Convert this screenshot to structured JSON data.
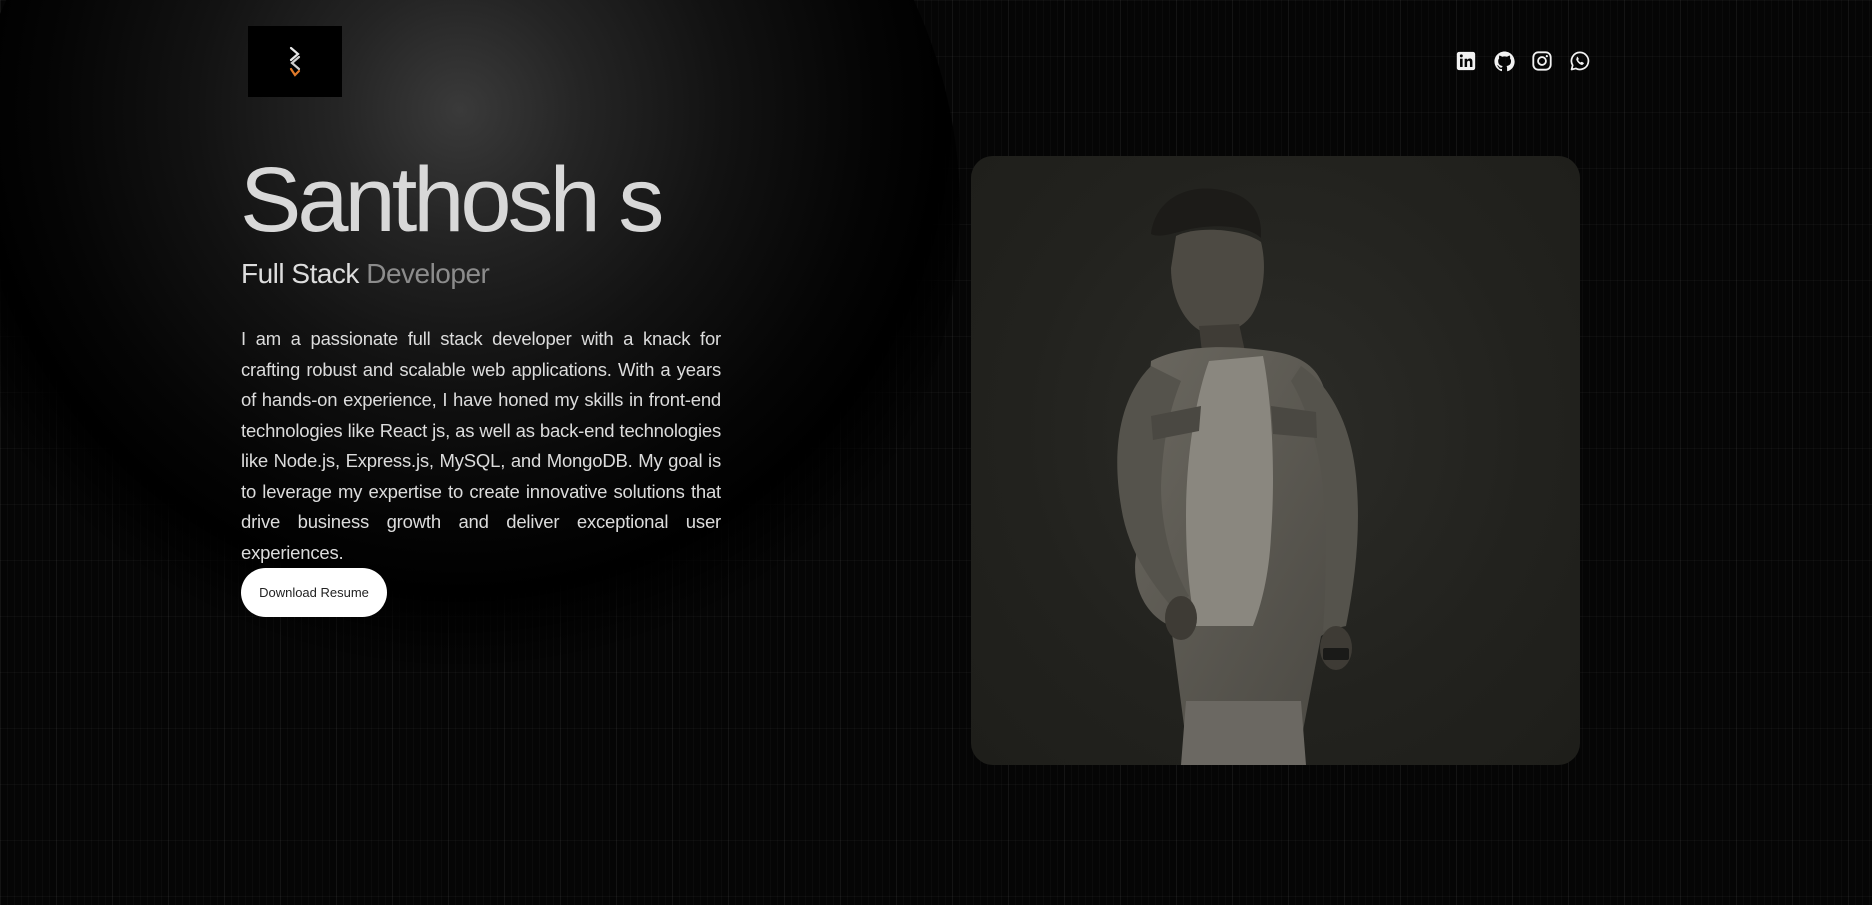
{
  "header": {
    "logo_glyph": "S",
    "socials": [
      {
        "icon": "linkedin-icon"
      },
      {
        "icon": "github-icon"
      },
      {
        "icon": "instagram-icon"
      },
      {
        "icon": "whatsapp-icon"
      }
    ]
  },
  "hero": {
    "name": "Santhosh s",
    "role_primary": "Full Stack",
    "role_secondary": "Developer",
    "bio": "I am a passionate full stack developer with a knack for crafting robust and scalable web applications. With a years of hands-on experience, I have honed my skills in front-end technologies like React js, as well as back-end technologies like Node.js, Express.js, MySQL, and MongoDB. My goal is to leverage my expertise to create innovative solutions that drive business growth and deliver exceptional user experiences.",
    "resume_button": "Download Resume"
  },
  "colors": {
    "background": "#050505",
    "text": "#dcdcdc",
    "muted": "#8c8c8c",
    "button_bg": "#ffffff",
    "card_bg": "#22221e",
    "logo_accent": "#e07a2a"
  }
}
